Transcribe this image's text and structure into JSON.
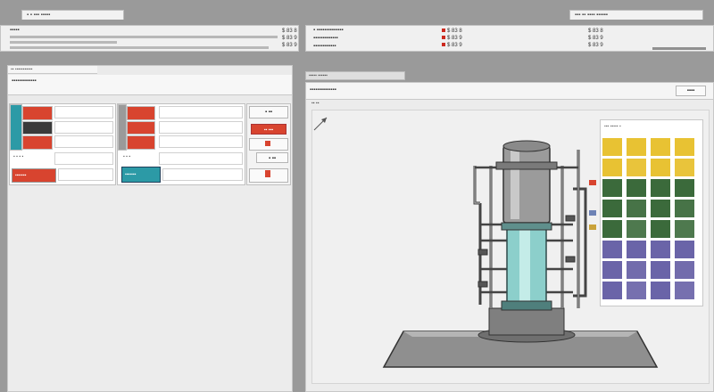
{
  "window": {
    "tab_left": "▪ ▪ ▪▪▪ ▪▪▪▪▪",
    "tab_mid": "▪ ▪▪▪▪▪▪ ▪▪▪▪▪▪",
    "tab_right": "▪▪▪ ▪▪ ▪▪▪▪ ▪▪▪▪▪▪"
  },
  "status_bar": {
    "left_title": "▪▪▪▪▪",
    "left_values": [
      "$ 83 8",
      "$ 83 9",
      "$ 83 9"
    ],
    "mid_labels": [
      "▪ ▪▪▪▪▪▪▪▪▪▪▪▪▪▪",
      "▪▪▪▪▪▪▪▪▪▪▪▪▪",
      "▪▪▪▪▪▪▪▪▪▪▪▪"
    ],
    "mid_values": [
      "$ 83 8",
      "$ 83 9",
      "$ 83 9"
    ],
    "right_values": [
      "$ 83 8",
      "$ 83 9",
      "$ 83 9"
    ]
  },
  "left_panel": {
    "tab_label": "▪▪ ▪▪▪▪▪▪▪▪▪▪▪",
    "title": "▪▪▪▪▪▪▪▪▪▪▪▪▪",
    "rows": [
      {
        "label": "",
        "value": ""
      },
      {
        "label": "",
        "value": ""
      },
      {
        "label": "",
        "value": ""
      },
      {
        "label": "",
        "value": ""
      },
      {
        "label": "",
        "value": ""
      },
      {
        "label": "",
        "value": ""
      }
    ],
    "footer_left": "▪ ▪ ▪ ▪",
    "footer_right": "▪ ▪ ▪",
    "swatch_label_left": "▪▪▪▪▪▪▪",
    "swatch_label_right": "▪▪▪▪▪▪▪",
    "side_value": "▪ ▪▪",
    "side_btn_label": "▪▪ ▪▪▪",
    "side_readout": "▪ ▪▪"
  },
  "right_panel": {
    "tab_label": "▪▪▪▪▪ ▪▪▪▪▪▪",
    "title": "▪▪▪▪▪▪▪▪▪▪▪▪▪▪",
    "close_button": "▪▪▪▪",
    "canvas_label": "▪▪ ▪▪",
    "legend_title": "▪▪▪ ▪▪▪▪▪ ▪"
  },
  "colors": {
    "accent_red": "#d8442f",
    "accent_teal": "#2c9aa6",
    "legend_yellow": "#e8c233",
    "legend_green": "#3b6a3b",
    "legend_purple": "#6a64a8"
  }
}
